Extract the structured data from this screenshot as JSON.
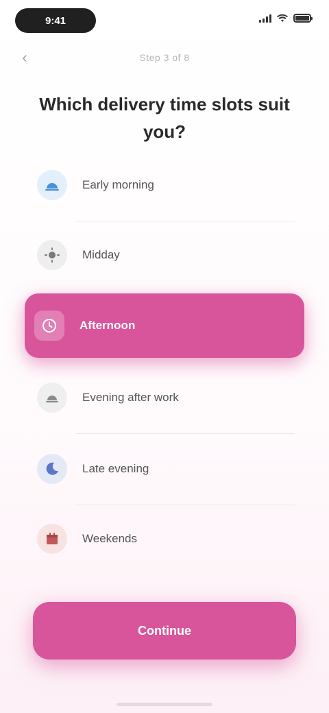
{
  "status_bar": {
    "time": "9:41"
  },
  "nav": {
    "back_glyph": "‹",
    "step_text": "Step 3 of 8"
  },
  "question": {
    "title": "Which delivery time slots suit you?"
  },
  "options": [
    {
      "label": "Early morning",
      "icon": "sunrise-icon",
      "icon_color": "#4a90d9",
      "icon_bg": "#e3effb",
      "selected": false
    },
    {
      "label": "Midday",
      "icon": "sun-icon",
      "icon_color": "#7a7a7a",
      "icon_bg": "#eeeeee",
      "selected": false
    },
    {
      "label": "Afternoon",
      "icon": "clock-icon",
      "icon_color": "#ffffff",
      "icon_bg": "rgba(255,255,255,0.25)",
      "selected": true
    },
    {
      "label": "Evening after work",
      "icon": "sunset-icon",
      "icon_color": "#8a8a8a",
      "icon_bg": "#efefef",
      "selected": false
    },
    {
      "label": "Late evening",
      "icon": "moon-icon",
      "icon_color": "#5b77c9",
      "icon_bg": "#e4e9f7",
      "selected": false
    },
    {
      "label": "Weekends",
      "icon": "calendar-icon",
      "icon_color": "#c05a5a",
      "icon_bg": "#f7e4e2",
      "selected": false
    }
  ],
  "continue_label": "Continue",
  "colors": {
    "accent": "#d9559b",
    "text": "#2a2a2a",
    "muted": "#b5b5b5"
  }
}
